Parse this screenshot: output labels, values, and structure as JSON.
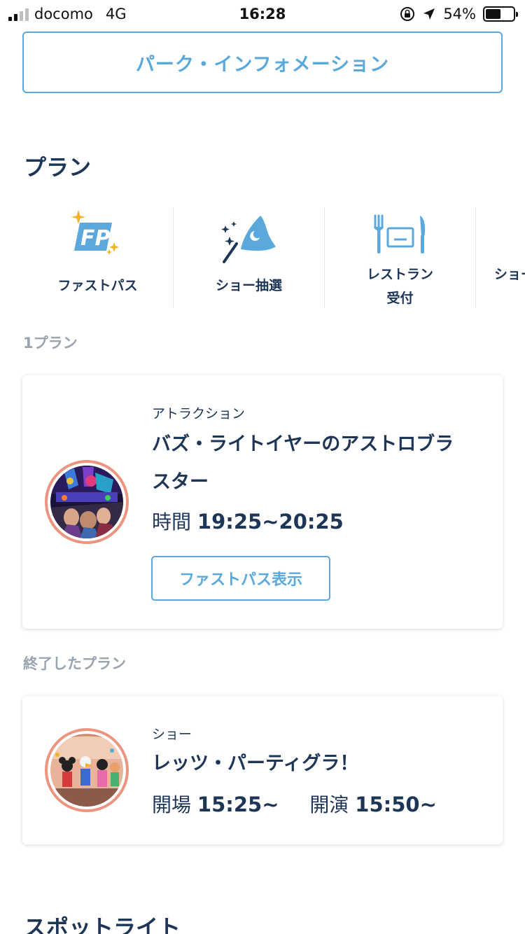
{
  "status_bar": {
    "carrier": "docomo",
    "network": "4G",
    "time": "16:28",
    "battery": "54%",
    "battery_level": 0.54
  },
  "park_info_button": "パーク・インフォメーション",
  "plan_section": {
    "title": "プラン",
    "menu": [
      {
        "label": "ファストパス",
        "icon": "fastpass-icon"
      },
      {
        "label": "ショー抽選",
        "icon": "wizard-hat-icon"
      },
      {
        "label_line1": "レストラン",
        "label_line2": "受付",
        "icon": "restaurant-icon"
      },
      {
        "label": "ショー",
        "icon": "show-icon"
      }
    ],
    "count_label": "1プラン"
  },
  "active_plan": {
    "category": "アトラクション",
    "title": "バズ・ライトイヤーのアストロブラスター",
    "time_label": "時間",
    "time_value": "19:25~20:25",
    "button": "ファストパス表示"
  },
  "finished_section": {
    "label": "終了したプラン"
  },
  "finished_plan": {
    "category": "ショー",
    "title": "レッツ・パーティグラ！",
    "open_label": "開場",
    "open_value": "15:25~",
    "show_label": "開演",
    "show_value": "15:50~"
  },
  "spotlight": {
    "title": "スポットライト"
  },
  "colors": {
    "accent": "#5aa8dc",
    "navy": "#1d3557",
    "gold": "#f0b429",
    "avatar_ring": "#ec9480",
    "muted": "#9aa4b0"
  }
}
